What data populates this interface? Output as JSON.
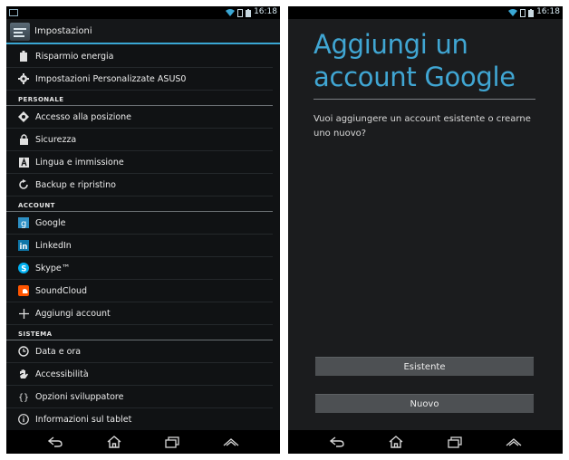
{
  "status": {
    "time": "16:18"
  },
  "settings": {
    "title": "Impostazioni",
    "groups": [
      {
        "header": "",
        "items": [
          {
            "label": "Risparmio energia",
            "icon": "battery-icon"
          },
          {
            "label": "Impostazioni Personalizzate ASUS0",
            "icon": "gear-icon"
          }
        ]
      },
      {
        "header": "PERSONALE",
        "items": [
          {
            "label": "Accesso alla posizione",
            "icon": "location-icon"
          },
          {
            "label": "Sicurezza",
            "icon": "lock-icon"
          },
          {
            "label": "Lingua e immissione",
            "icon": "keyboard-a-icon"
          },
          {
            "label": "Backup e ripristino",
            "icon": "backup-icon"
          }
        ]
      },
      {
        "header": "ACCOUNT",
        "items": [
          {
            "label": "Google",
            "icon": "google-icon"
          },
          {
            "label": "LinkedIn",
            "icon": "linkedin-icon"
          },
          {
            "label": "Skype™",
            "icon": "skype-icon"
          },
          {
            "label": "SoundCloud",
            "icon": "soundcloud-icon"
          },
          {
            "label": "Aggiungi account",
            "icon": "plus-icon"
          }
        ]
      },
      {
        "header": "SISTEMA",
        "items": [
          {
            "label": "Data e ora",
            "icon": "clock-icon"
          },
          {
            "label": "Accessibilità",
            "icon": "hand-icon"
          },
          {
            "label": "Opzioni sviluppatore",
            "icon": "braces-icon"
          },
          {
            "label": "Informazioni sul tablet",
            "icon": "info-icon"
          }
        ]
      }
    ]
  },
  "add_account": {
    "heading": "Aggiungi un account Google",
    "question": "Vuoi aggiungere un account esistente o crearne uno nuovo?",
    "existing_label": "Esistente",
    "new_label": "Nuovo"
  },
  "colors": {
    "accent": "#3aa7d4",
    "heading": "#40a6d3",
    "linkedin": "#0e76a8",
    "skype": "#00aff0",
    "soundcloud": "#ff5500"
  }
}
